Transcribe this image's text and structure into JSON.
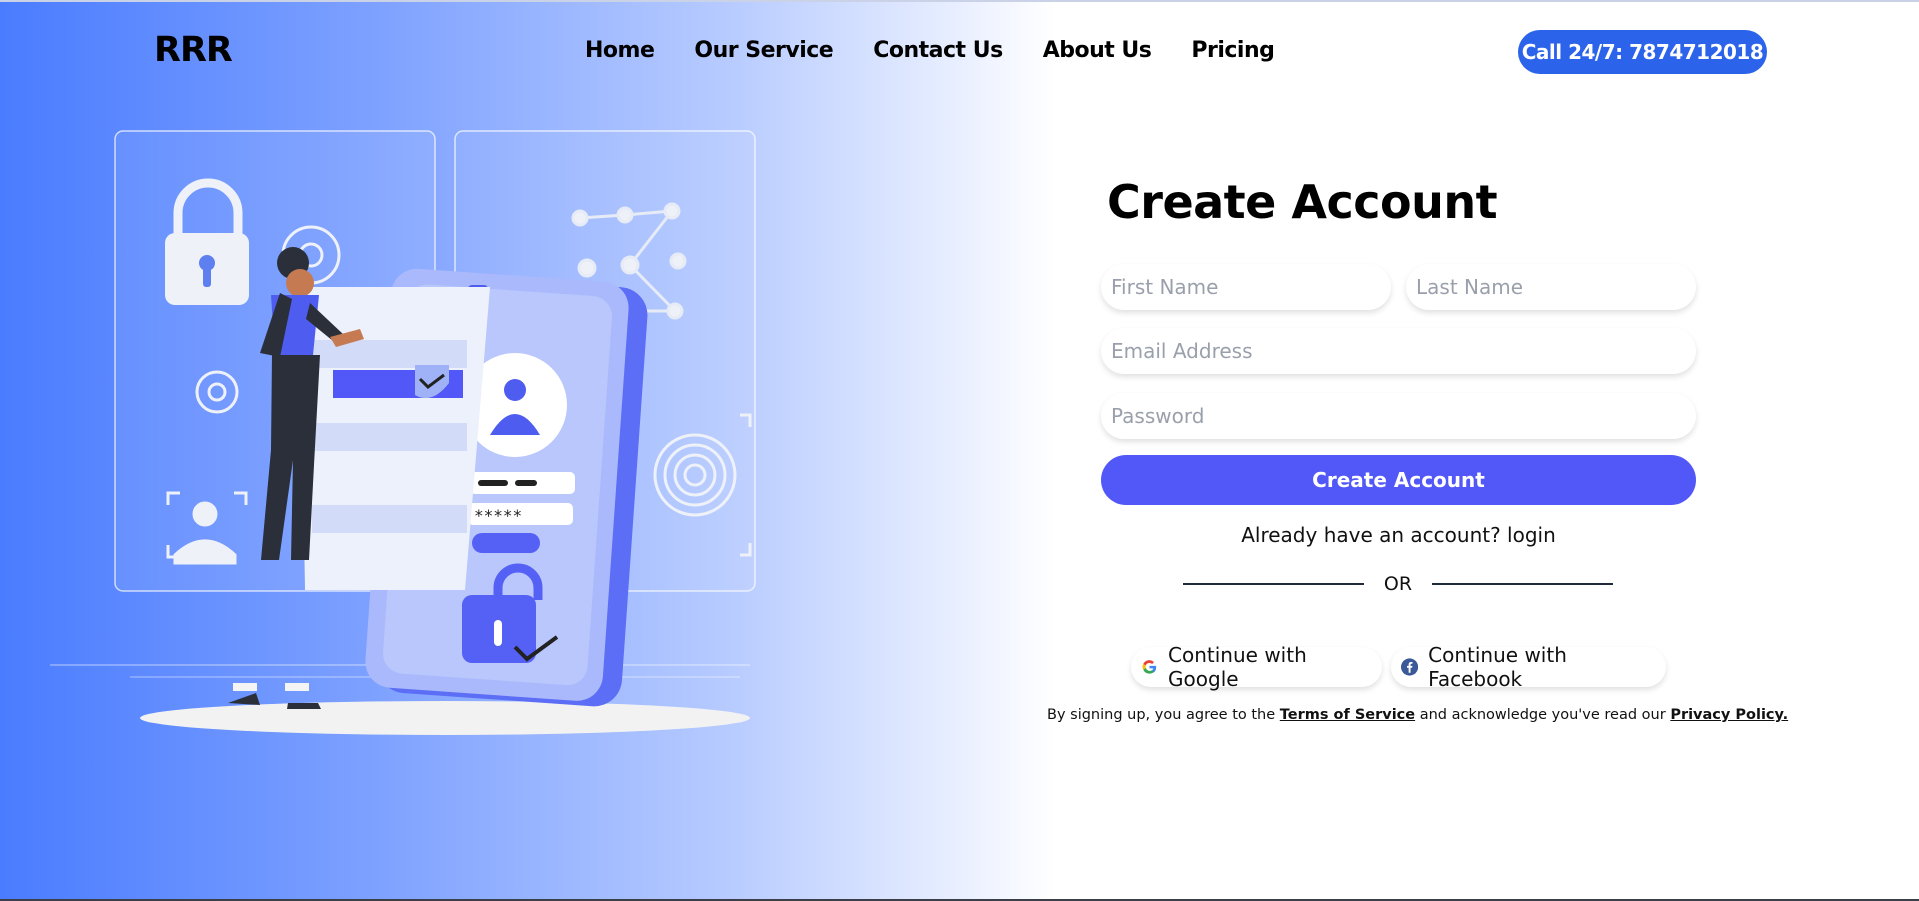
{
  "brand": {
    "logo": "RRR"
  },
  "nav": {
    "items": [
      {
        "label": "Home"
      },
      {
        "label": "Our Service"
      },
      {
        "label": "Contact Us"
      },
      {
        "label": "About Us"
      },
      {
        "label": "Pricing"
      }
    ],
    "call_button": "Call 24/7: 7874712018"
  },
  "illustration": {
    "password_mask": "*****"
  },
  "form": {
    "title": "Create Account",
    "first_name_placeholder": "First Name",
    "last_name_placeholder": "Last Name",
    "email_placeholder": "Email Address",
    "password_placeholder": "Password",
    "submit_label": "Create Account",
    "login_prompt": "Already have an account? login",
    "divider": "OR",
    "google_label": "Continue with Google",
    "facebook_label": "Continue with Facebook",
    "terms_prefix": "By signing up, you agree to the ",
    "terms_link": "Terms of Service",
    "terms_middle": " and acknowledge you've read our ",
    "privacy_link": "Privacy Policy."
  },
  "colors": {
    "primary": "#5258f8",
    "call_button": "#2b63ea",
    "gradient_start": "#4a7cff"
  }
}
